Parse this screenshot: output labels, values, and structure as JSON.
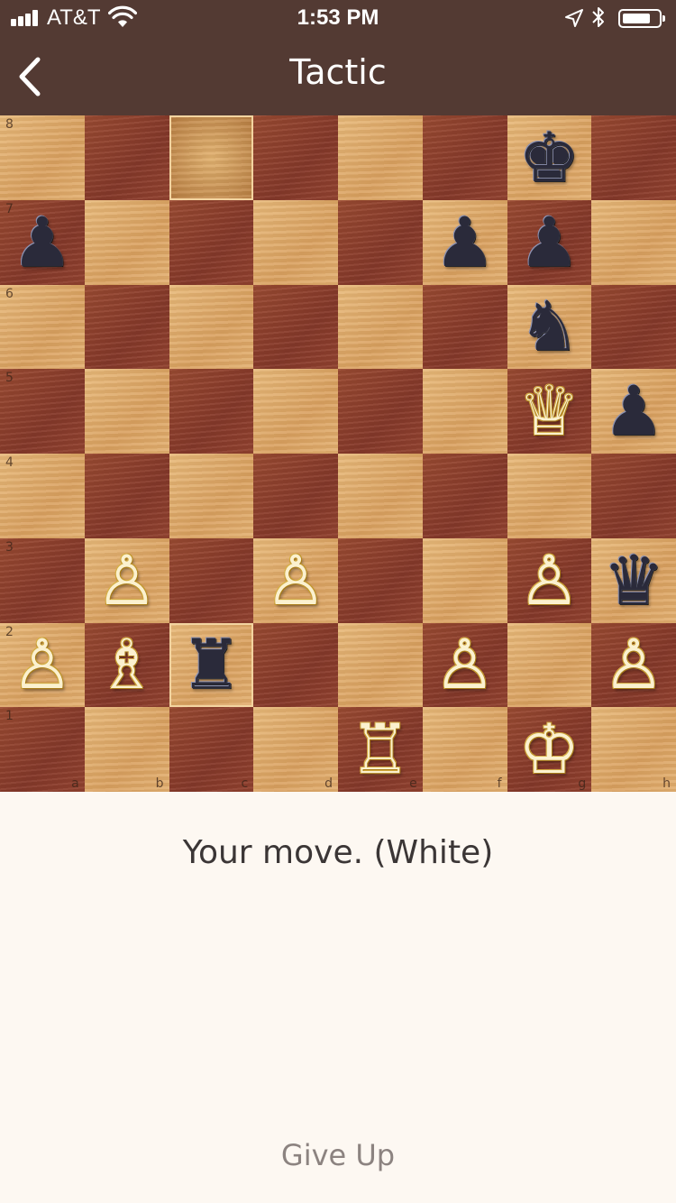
{
  "status_bar": {
    "carrier": "AT&T",
    "time": "1:53 PM",
    "signal_bars": 4,
    "battery_level": 0.8,
    "icons": [
      "wifi-icon",
      "location-arrow-icon",
      "bluetooth-icon",
      "battery-icon"
    ]
  },
  "nav": {
    "back_icon": "chevron-left-icon",
    "title": "Tactic"
  },
  "board": {
    "orientation": "white",
    "files": [
      "a",
      "b",
      "c",
      "d",
      "e",
      "f",
      "g",
      "h"
    ],
    "ranks": [
      "8",
      "7",
      "6",
      "5",
      "4",
      "3",
      "2",
      "1"
    ],
    "highlighted_squares": [
      "c8",
      "c2"
    ],
    "pieces": {
      "g8": {
        "color": "black",
        "type": "king",
        "glyph": "♚"
      },
      "a7": {
        "color": "black",
        "type": "pawn",
        "glyph": "♟"
      },
      "f7": {
        "color": "black",
        "type": "pawn",
        "glyph": "♟"
      },
      "g7": {
        "color": "black",
        "type": "pawn",
        "glyph": "♟"
      },
      "g6": {
        "color": "black",
        "type": "knight",
        "glyph": "♞"
      },
      "g5": {
        "color": "white",
        "type": "queen",
        "glyph": "♕"
      },
      "h5": {
        "color": "black",
        "type": "pawn",
        "glyph": "♟"
      },
      "b3": {
        "color": "white",
        "type": "pawn",
        "glyph": "♙"
      },
      "d3": {
        "color": "white",
        "type": "pawn",
        "glyph": "♙"
      },
      "g3": {
        "color": "white",
        "type": "pawn",
        "glyph": "♙"
      },
      "h3": {
        "color": "black",
        "type": "queen",
        "glyph": "♛"
      },
      "a2": {
        "color": "white",
        "type": "pawn",
        "glyph": "♙"
      },
      "b2": {
        "color": "white",
        "type": "bishop",
        "glyph": "♗"
      },
      "c2": {
        "color": "black",
        "type": "rook",
        "glyph": "♜"
      },
      "f2": {
        "color": "white",
        "type": "pawn",
        "glyph": "♙"
      },
      "h2": {
        "color": "white",
        "type": "pawn",
        "glyph": "♙"
      },
      "e1": {
        "color": "white",
        "type": "rook",
        "glyph": "♖"
      },
      "g1": {
        "color": "white",
        "type": "king",
        "glyph": "♔"
      }
    }
  },
  "message": "Your move. (White)",
  "give_up_label": "Give Up",
  "colors": {
    "header_bg": "#533a33",
    "page_bg": "#fdf8f2",
    "light_square": "#e2ae6e",
    "dark_square": "#8e3f2d"
  }
}
